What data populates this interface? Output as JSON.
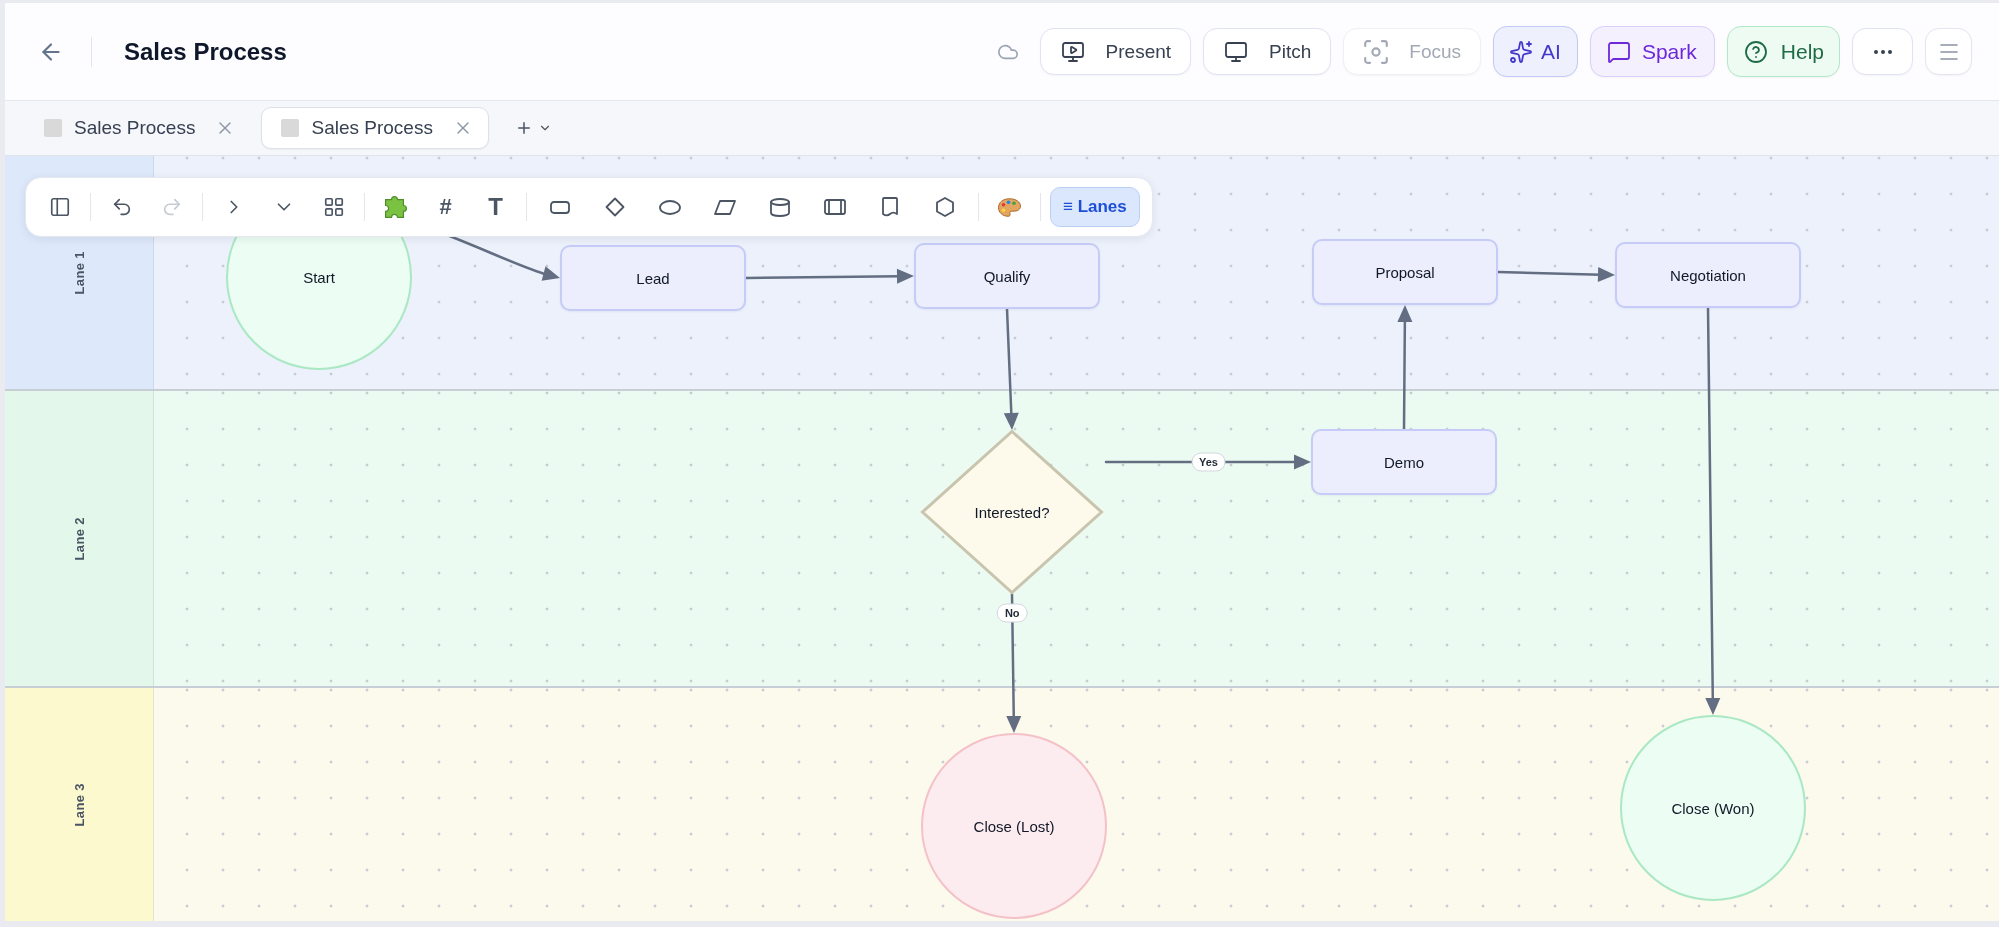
{
  "header": {
    "title": "Sales Process",
    "buttons": [
      {
        "kind": "present",
        "label": "Present",
        "disabled": false
      },
      {
        "kind": "pitch",
        "label": "Pitch",
        "disabled": false
      },
      {
        "kind": "focus",
        "label": "Focus",
        "disabled": true
      },
      {
        "kind": "ai",
        "label": "AI",
        "disabled": false
      },
      {
        "kind": "spark",
        "label": "Spark",
        "disabled": false
      },
      {
        "kind": "help",
        "label": "Help",
        "disabled": false
      }
    ]
  },
  "tabs": [
    {
      "label": "Sales Process",
      "selected": false
    },
    {
      "label": "Sales Process",
      "selected": true
    }
  ],
  "toolbar": {
    "history": [
      {
        "kind": "undo",
        "disabled": false
      },
      {
        "kind": "redo",
        "disabled": true
      }
    ],
    "text_tools": [
      "#",
      "T"
    ],
    "lanes_button": {
      "label": "≡ Lanes",
      "active": true
    }
  },
  "lanes": [
    {
      "label": "Lane 1",
      "color": "#dde8fb"
    },
    {
      "label": "Lane 2",
      "color": "#e3f8ea"
    },
    {
      "label": "Lane 3",
      "color": "#fdf9cf"
    }
  ],
  "nodes": [
    {
      "kind": "terminal",
      "label": "Start",
      "color": "#a9e8c3"
    },
    {
      "kind": "process",
      "label": "Lead",
      "color": "#c6ccf7"
    },
    {
      "kind": "process",
      "label": "Qualify",
      "color": "#c6ccf7"
    },
    {
      "kind": "process",
      "label": "Proposal",
      "color": "#c6ccf7"
    },
    {
      "kind": "process",
      "label": "Negotiation",
      "color": "#c6ccf7"
    },
    {
      "kind": "decision",
      "label": "Interested?",
      "color": "#c9c4ad"
    },
    {
      "kind": "process",
      "label": "Demo",
      "color": "#c6ccf7"
    },
    {
      "kind": "terminal",
      "label": "Close (Lost)",
      "color": "#f4c1c9"
    },
    {
      "kind": "terminal",
      "label": "Close (Won)",
      "color": "#a9e8c3"
    }
  ],
  "edges": [
    {
      "kind": "curved"
    },
    {
      "kind": "straight"
    },
    {
      "kind": "straight"
    },
    {
      "kind": "straight",
      "label": "Yes"
    },
    {
      "kind": "straight",
      "label": "No"
    },
    {
      "kind": "straight"
    },
    {
      "kind": "straight"
    },
    {
      "kind": "straight"
    }
  ]
}
